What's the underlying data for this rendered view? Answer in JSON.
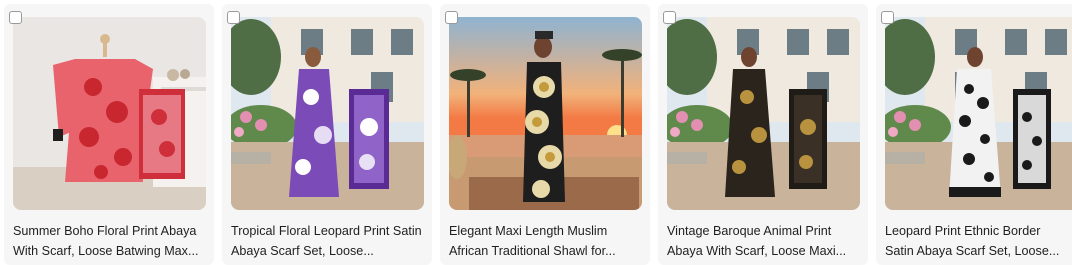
{
  "products": [
    {
      "title": "Summer Boho Floral Print Abaya With Scarf, Loose Batwing Max...",
      "image": "red floral abaya on mannequin with scarf"
    },
    {
      "title": "Tropical Floral Leopard Print Satin Abaya Scarf Set, Loose...",
      "image": "woman in purple floral abaya with scarf, villa garden"
    },
    {
      "title": "Elegant Maxi Length Muslim African Traditional Shawl for...",
      "image": "woman in black and gold maxi dress on beach at sunset"
    },
    {
      "title": "Vintage Baroque Animal Print Abaya With Scarf, Loose Maxi...",
      "image": "woman in black baroque abaya with scarf, villa garden"
    },
    {
      "title": "Leopard Print Ethnic Border Satin Abaya Scarf Set, Loose...",
      "image": "woman in black and white leopard abaya with scarf, villa garden"
    }
  ],
  "colors": {
    "card_bg": "#f6f6f7",
    "title": "#1f1f1f",
    "checkbox_border": "#9a9a9a"
  },
  "icons": {
    "select": "checkbox-icon"
  }
}
